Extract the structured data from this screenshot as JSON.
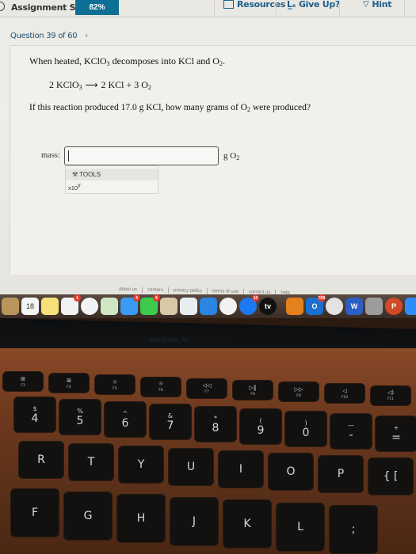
{
  "topbar": {
    "score_label": "Assignment Score:",
    "score_value": "82%",
    "score_color": "#0e6f95",
    "resources_label": "Resources",
    "give_up_label": "Give Up?",
    "hint_label": "Hint"
  },
  "question_nav": {
    "label": "Question 39 of 60",
    "next_icon": "chevron-right-icon"
  },
  "question": {
    "intro_prefix": "When heated, KClO",
    "intro_sub1": "3",
    "intro_mid": " decomposes into KCl and O",
    "intro_sub2": "2",
    "intro_suffix": ".",
    "equation": {
      "reactant_coef": "2",
      "reactant": "KClO",
      "reactant_sub": "3",
      "arrow": "⟶",
      "product1": "2 KCl + 3 O",
      "product1_sub": "2"
    },
    "ask_prefix": "If this reaction produced 17.0 g KCl, how many grams of O",
    "ask_sub": "2",
    "ask_suffix": " were produced?"
  },
  "answer": {
    "mass_label": "mass:",
    "input_value": "",
    "unit_prefix": "g O",
    "unit_sub": "2",
    "tools_label": "TOOLS",
    "x10_label": "x10",
    "x10_sup": "y"
  },
  "footer_links": [
    "about us",
    "careers",
    "privacy policy",
    "terms of use",
    "contact us",
    "help"
  ],
  "dock": {
    "apps": [
      {
        "name": "contacts",
        "label": "",
        "color": "#b8955a",
        "badge": ""
      },
      {
        "name": "calendar",
        "label": "18",
        "color": "#f4f4f4",
        "badge": ""
      },
      {
        "name": "notes",
        "label": "",
        "color": "#f7e27a",
        "badge": ""
      },
      {
        "name": "reminders",
        "label": "",
        "color": "#f1f1f1",
        "badge": "1"
      },
      {
        "name": "photos",
        "label": "",
        "color": "#f3f3f3",
        "badge": ""
      },
      {
        "name": "maps",
        "label": "",
        "color": "#cfe6c4",
        "badge": ""
      },
      {
        "name": "messages",
        "label": "",
        "color": "#3a9bf5",
        "badge": "4"
      },
      {
        "name": "facetime",
        "label": "",
        "color": "#3ccb4e",
        "badge": "6"
      },
      {
        "name": "preview",
        "label": "",
        "color": "#d9c8a6",
        "badge": ""
      },
      {
        "name": "numbers",
        "label": "",
        "color": "#e8eef0",
        "badge": ""
      },
      {
        "name": "keynote",
        "label": "",
        "color": "#2a86e0",
        "badge": ""
      },
      {
        "name": "news",
        "label": "",
        "color": "#f2f2f2",
        "badge": ""
      },
      {
        "name": "app-store",
        "label": "",
        "color": "#1d7af2",
        "badge": "10"
      },
      {
        "name": "apple-tv",
        "label": "tv",
        "color": "#111111",
        "badge": ""
      },
      {
        "name": "books",
        "label": "",
        "color": "#e5801f",
        "badge": ""
      },
      {
        "name": "outlook",
        "label": "O",
        "color": "#1b6fd0",
        "badge": "708"
      },
      {
        "name": "chrome",
        "label": "",
        "color": "#e3e3e3",
        "badge": ""
      },
      {
        "name": "word",
        "label": "W",
        "color": "#2b5fc4",
        "badge": ""
      },
      {
        "name": "keyboard-viewer",
        "label": "",
        "color": "#9c9c9c",
        "badge": ""
      },
      {
        "name": "powerpoint",
        "label": "P",
        "color": "#d24a26",
        "badge": ""
      },
      {
        "name": "zoom",
        "label": "",
        "color": "#2d8cff",
        "badge": ""
      }
    ]
  },
  "laptop_brand": "MacBook Air",
  "keyboard": {
    "fn_row": [
      {
        "icon": "⊞",
        "label": "F3"
      },
      {
        "icon": "⊞",
        "label": "F4"
      },
      {
        "icon": "☼",
        "label": "F5"
      },
      {
        "icon": "☼",
        "label": "F6"
      },
      {
        "icon": "◁◁",
        "label": "F7"
      },
      {
        "icon": "▷‖",
        "label": "F8"
      },
      {
        "icon": "▷▷",
        "label": "F9"
      },
      {
        "icon": "◁",
        "label": "F10"
      },
      {
        "icon": "◁)",
        "label": "F11"
      }
    ],
    "number_row": [
      {
        "top": "$",
        "main": "4"
      },
      {
        "top": "%",
        "main": "5"
      },
      {
        "top": "^",
        "main": "6"
      },
      {
        "top": "&",
        "main": "7"
      },
      {
        "top": "*",
        "main": "8"
      },
      {
        "top": "(",
        "main": "9"
      },
      {
        "top": ")",
        "main": "0"
      },
      {
        "top": "—",
        "main": "-"
      },
      {
        "top": "+",
        "main": "="
      }
    ],
    "top_row": [
      "R",
      "T",
      "Y",
      "U",
      "I",
      "O",
      "P",
      "{ ["
    ],
    "home_row": [
      "F",
      "G",
      "H",
      "J",
      "K",
      "L",
      ";"
    ]
  }
}
